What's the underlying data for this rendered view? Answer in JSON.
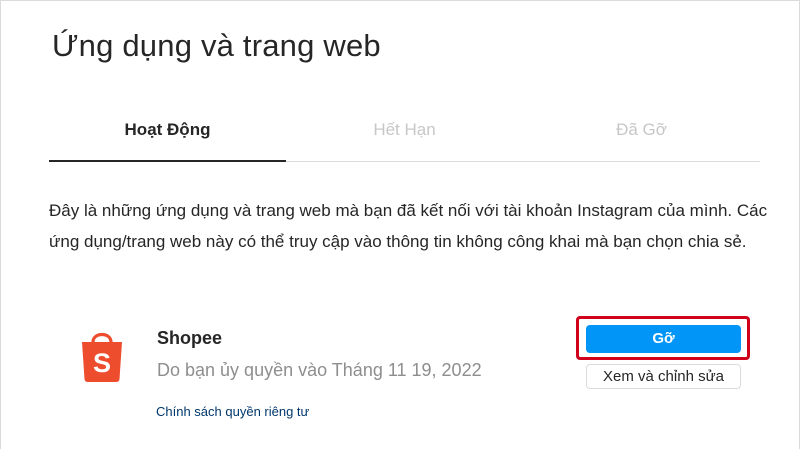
{
  "page": {
    "title": "Ứng dụng và trang web"
  },
  "tabs": [
    {
      "label": "Hoạt Động",
      "active": true
    },
    {
      "label": "Hết Hạn",
      "active": false
    },
    {
      "label": "Đã Gỡ",
      "active": false
    }
  ],
  "description": "Đây là những ứng dụng và trang web mà bạn đã kết nối với tài khoản Instagram của mình. Các ứng dụng/trang web này có thể truy cập vào thông tin không công khai mà bạn chọn chia sẻ.",
  "app": {
    "name": "Shopee",
    "authorized": "Do bạn ủy quyền vào Tháng 11 19, 2022",
    "privacy_link": "Chính sách quyền riêng tư",
    "logo_icon": "shopee-bag-icon",
    "logo_letter": "S",
    "remove_label": "Gỡ",
    "edit_label": "Xem và chỉnh sửa"
  },
  "colors": {
    "shopee_orange": "#ee4d2d",
    "primary_blue": "#0095f6",
    "highlight_red": "#d0021b",
    "link_blue": "#00376b"
  }
}
